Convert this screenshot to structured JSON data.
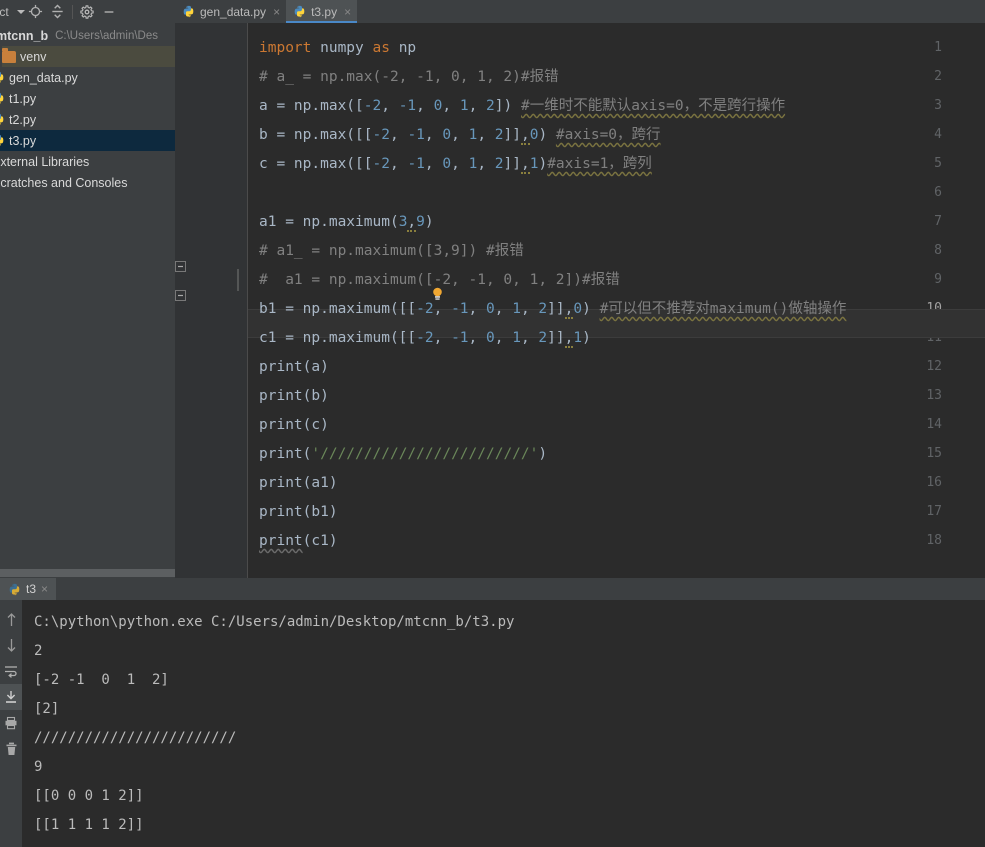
{
  "window": {
    "ide": "PyCharm",
    "theme_bg": "#3c3f41",
    "editor_bg": "#2b2b2b",
    "accent": "#4a88c7"
  },
  "toolbar": {
    "project_label": "oject",
    "icons": [
      "locate-icon",
      "collapse-all-icon",
      "settings-gear-icon",
      "minimize-icon"
    ]
  },
  "tabs": [
    {
      "label": "gen_data.py",
      "close": "×",
      "active": false
    },
    {
      "label": "t3.py",
      "close": "×",
      "active": true
    }
  ],
  "project_panel": {
    "root": {
      "name": "mtcnn_b",
      "path": "C:\\Users\\admin\\Des"
    },
    "items": [
      {
        "label": "venv",
        "icon": "folder-icon",
        "state": "hover"
      },
      {
        "label": "gen_data.py",
        "icon": "python-file-icon",
        "state": "normal"
      },
      {
        "label": "t1.py",
        "icon": "python-file-icon",
        "state": "normal"
      },
      {
        "label": "t2.py",
        "icon": "python-file-icon",
        "state": "normal"
      },
      {
        "label": "t3.py",
        "icon": "python-file-icon",
        "state": "selected"
      },
      {
        "label": "External Libraries",
        "icon": "none",
        "state": "normal"
      },
      {
        "label": "Scratches and Consoles",
        "icon": "none",
        "state": "normal"
      }
    ]
  },
  "editor": {
    "current_line": 10,
    "line_numbers": [
      1,
      2,
      3,
      4,
      5,
      6,
      7,
      8,
      9,
      10,
      11,
      12,
      13,
      14,
      15,
      16,
      17,
      18
    ],
    "lines": [
      {
        "n": 1,
        "tokens": [
          {
            "t": "import ",
            "c": "k"
          },
          {
            "t": "numpy ",
            "c": "id"
          },
          {
            "t": "as ",
            "c": "k"
          },
          {
            "t": "np",
            "c": "id"
          }
        ]
      },
      {
        "n": 2,
        "tokens": [
          {
            "t": "# a_ = np.max(-2, -1, 0, 1, 2)#报错",
            "c": "cm"
          }
        ]
      },
      {
        "n": 3,
        "tokens": [
          {
            "t": "a = np.max([",
            "c": "id"
          },
          {
            "t": "-2",
            "c": "nu"
          },
          {
            "t": ", ",
            "c": "id"
          },
          {
            "t": "-1",
            "c": "nu"
          },
          {
            "t": ", ",
            "c": "id"
          },
          {
            "t": "0",
            "c": "nu"
          },
          {
            "t": ", ",
            "c": "id"
          },
          {
            "t": "1",
            "c": "nu"
          },
          {
            "t": ", ",
            "c": "id"
          },
          {
            "t": "2",
            "c": "nu"
          },
          {
            "t": "]) ",
            "c": "id"
          },
          {
            "t": "#一维时不能默认axis=0，不是跨行操作",
            "c": "cm wav"
          }
        ]
      },
      {
        "n": 4,
        "tokens": [
          {
            "t": "b = np.max([[",
            "c": "id"
          },
          {
            "t": "-2",
            "c": "nu"
          },
          {
            "t": ", ",
            "c": "id"
          },
          {
            "t": "-1",
            "c": "nu"
          },
          {
            "t": ", ",
            "c": "id"
          },
          {
            "t": "0",
            "c": "nu"
          },
          {
            "t": ", ",
            "c": "id"
          },
          {
            "t": "1",
            "c": "nu"
          },
          {
            "t": ", ",
            "c": "id"
          },
          {
            "t": "2",
            "c": "nu"
          },
          {
            "t": "]]",
            "c": "id"
          },
          {
            "t": ",",
            "c": "id err"
          },
          {
            "t": "0",
            "c": "nu"
          },
          {
            "t": ") ",
            "c": "id"
          },
          {
            "t": "#axis=0，跨行",
            "c": "cm wav"
          }
        ]
      },
      {
        "n": 5,
        "tokens": [
          {
            "t": "c = np.max([[",
            "c": "id"
          },
          {
            "t": "-2",
            "c": "nu"
          },
          {
            "t": ", ",
            "c": "id"
          },
          {
            "t": "-1",
            "c": "nu"
          },
          {
            "t": ", ",
            "c": "id"
          },
          {
            "t": "0",
            "c": "nu"
          },
          {
            "t": ", ",
            "c": "id"
          },
          {
            "t": "1",
            "c": "nu"
          },
          {
            "t": ", ",
            "c": "id"
          },
          {
            "t": "2",
            "c": "nu"
          },
          {
            "t": "]]",
            "c": "id"
          },
          {
            "t": ",",
            "c": "id err"
          },
          {
            "t": "1",
            "c": "nu"
          },
          {
            "t": ")",
            "c": "id"
          },
          {
            "t": "#axis=1，跨列",
            "c": "cm wav"
          }
        ]
      },
      {
        "n": 6,
        "tokens": []
      },
      {
        "n": 7,
        "tokens": [
          {
            "t": "a1 = np.maximum(",
            "c": "id"
          },
          {
            "t": "3",
            "c": "nu"
          },
          {
            "t": ",",
            "c": "id err"
          },
          {
            "t": "9",
            "c": "nu"
          },
          {
            "t": ")",
            "c": "id"
          }
        ]
      },
      {
        "n": 8,
        "tokens": [
          {
            "t": "# a1_ = np.maximum([3,9]) #报错",
            "c": "cm"
          }
        ]
      },
      {
        "n": 9,
        "tokens": [
          {
            "t": "#  a1 = np.maximum([-2, -1, 0, 1, 2])#报错",
            "c": "cm"
          }
        ]
      },
      {
        "n": 10,
        "tokens": [
          {
            "t": "b1 = np.maximum([[",
            "c": "id"
          },
          {
            "t": "-2",
            "c": "nu"
          },
          {
            "t": ", ",
            "c": "id"
          },
          {
            "t": "-1",
            "c": "nu"
          },
          {
            "t": ", ",
            "c": "id"
          },
          {
            "t": "0",
            "c": "nu"
          },
          {
            "t": ", ",
            "c": "id"
          },
          {
            "t": "1",
            "c": "nu"
          },
          {
            "t": ", ",
            "c": "id"
          },
          {
            "t": "2",
            "c": "nu"
          },
          {
            "t": "]]",
            "c": "id"
          },
          {
            "t": ",",
            "c": "id err"
          },
          {
            "t": "0",
            "c": "nu"
          },
          {
            "t": ") ",
            "c": "id"
          },
          {
            "t": "#可以但不推荐对maximum()做轴操作",
            "c": "cm wav"
          }
        ]
      },
      {
        "n": 11,
        "tokens": [
          {
            "t": "c1 = np.maximum([[",
            "c": "id"
          },
          {
            "t": "-2",
            "c": "nu"
          },
          {
            "t": ", ",
            "c": "id"
          },
          {
            "t": "-1",
            "c": "nu"
          },
          {
            "t": ", ",
            "c": "id"
          },
          {
            "t": "0",
            "c": "nu"
          },
          {
            "t": ", ",
            "c": "id"
          },
          {
            "t": "1",
            "c": "nu"
          },
          {
            "t": ", ",
            "c": "id"
          },
          {
            "t": "2",
            "c": "nu"
          },
          {
            "t": "]]",
            "c": "id"
          },
          {
            "t": ",",
            "c": "id err"
          },
          {
            "t": "1",
            "c": "nu"
          },
          {
            "t": ")",
            "c": "id"
          }
        ]
      },
      {
        "n": 12,
        "tokens": [
          {
            "t": "print",
            "c": "id"
          },
          {
            "t": "(a)",
            "c": "id"
          }
        ]
      },
      {
        "n": 13,
        "tokens": [
          {
            "t": "print",
            "c": "id"
          },
          {
            "t": "(b)",
            "c": "id"
          }
        ]
      },
      {
        "n": 14,
        "tokens": [
          {
            "t": "print",
            "c": "id"
          },
          {
            "t": "(c)",
            "c": "id"
          }
        ]
      },
      {
        "n": 15,
        "tokens": [
          {
            "t": "print",
            "c": "id"
          },
          {
            "t": "(",
            "c": "id"
          },
          {
            "t": "'////////////////////////'",
            "c": "st"
          },
          {
            "t": ")",
            "c": "id"
          }
        ]
      },
      {
        "n": 16,
        "tokens": [
          {
            "t": "print",
            "c": "id"
          },
          {
            "t": "(a1)",
            "c": "id"
          }
        ]
      },
      {
        "n": 17,
        "tokens": [
          {
            "t": "print",
            "c": "id"
          },
          {
            "t": "(b1)",
            "c": "id"
          }
        ]
      },
      {
        "n": 18,
        "tokens": [
          {
            "t": "print",
            "c": "typo id"
          },
          {
            "t": "(c1)",
            "c": "id"
          }
        ]
      }
    ],
    "fold_markers": [
      {
        "line": 8,
        "icon": "fold-collapse-icon"
      },
      {
        "line": 9,
        "icon": "fold-collapse-icon"
      }
    ],
    "intention_bulb": {
      "line": 9,
      "icon": "lightbulb-icon"
    }
  },
  "console": {
    "tab": {
      "label": "t3",
      "icon": "python-run-icon",
      "close": "×"
    },
    "side_buttons": [
      "scroll-up-icon",
      "scroll-down-icon",
      "soft-wrap-icon",
      "scroll-to-end-icon",
      "print-icon",
      "trash-icon"
    ],
    "output": [
      "C:\\python\\python.exe C:/Users/admin/Desktop/mtcnn_b/t3.py",
      "2",
      "[-2 -1  0  1  2]",
      "[2]",
      "////////////////////////",
      "9",
      "[[0 0 0 1 2]]",
      "[[1 1 1 1 2]]"
    ]
  }
}
